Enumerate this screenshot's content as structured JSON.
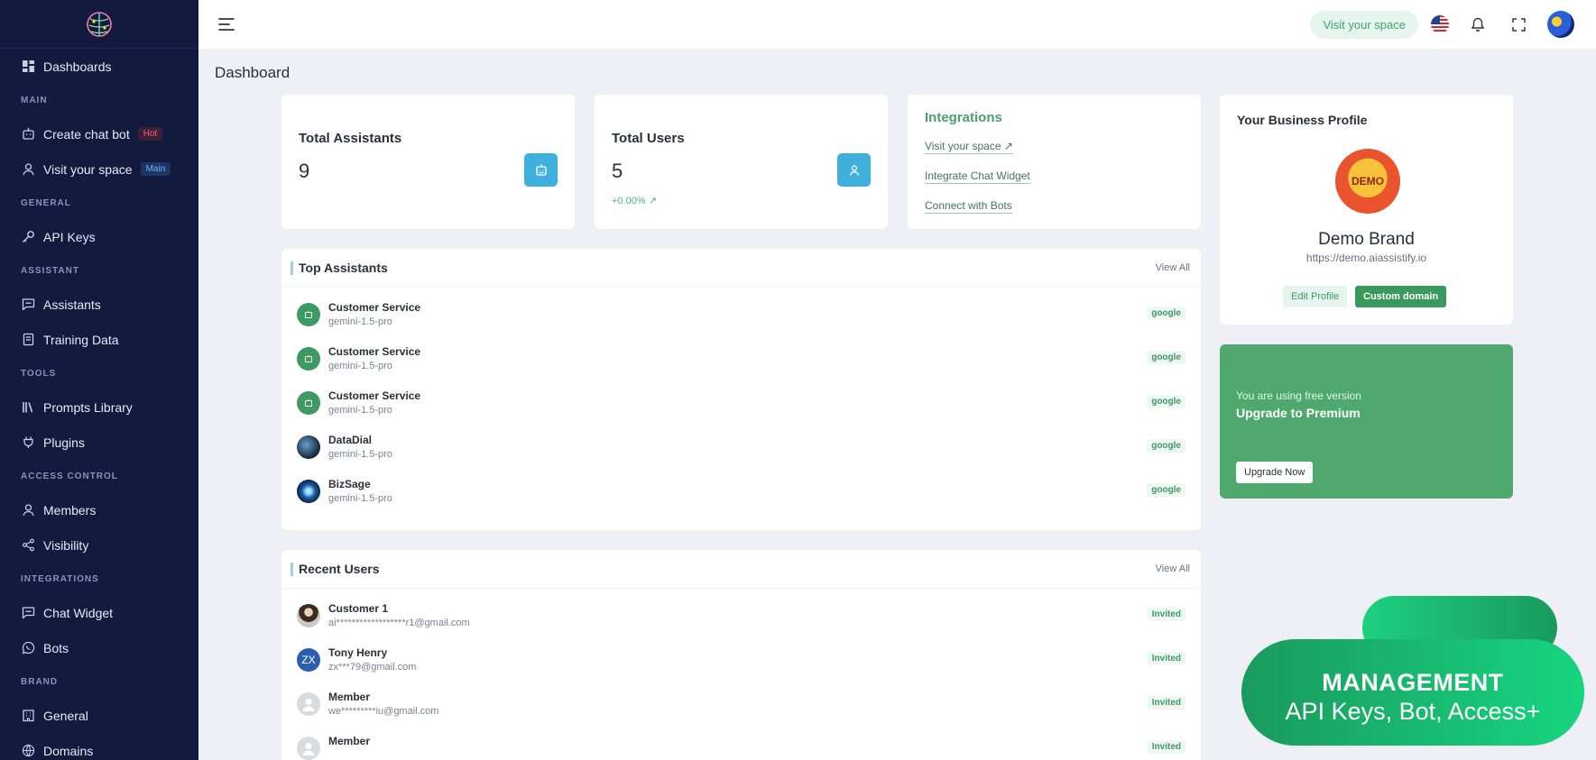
{
  "sidebar": {
    "items": [
      {
        "type": "item",
        "label": "Dashboards",
        "icon": "grid-icon"
      },
      {
        "type": "cat",
        "label": "MAIN"
      },
      {
        "type": "item",
        "label": "Create chat bot",
        "icon": "bot-icon",
        "badge": "Hot",
        "badge_kind": "hot"
      },
      {
        "type": "item",
        "label": "Visit your space",
        "icon": "user-icon",
        "badge": "Main",
        "badge_kind": "main"
      },
      {
        "type": "cat",
        "label": "GENERAL"
      },
      {
        "type": "item",
        "label": "API Keys",
        "icon": "key-icon"
      },
      {
        "type": "cat",
        "label": "ASSISTANT"
      },
      {
        "type": "item",
        "label": "Assistants",
        "icon": "chat-icon"
      },
      {
        "type": "item",
        "label": "Training Data",
        "icon": "book-icon"
      },
      {
        "type": "cat",
        "label": "TOOLS"
      },
      {
        "type": "item",
        "label": "Prompts Library",
        "icon": "library-icon"
      },
      {
        "type": "item",
        "label": "Plugins",
        "icon": "plug-icon"
      },
      {
        "type": "cat",
        "label": "ACCESS CONTROL"
      },
      {
        "type": "item",
        "label": "Members",
        "icon": "user-icon"
      },
      {
        "type": "item",
        "label": "Visibility",
        "icon": "share-icon"
      },
      {
        "type": "cat",
        "label": "INTEGRATIONS"
      },
      {
        "type": "item",
        "label": "Chat Widget",
        "icon": "chat-icon"
      },
      {
        "type": "item",
        "label": "Bots",
        "icon": "whatsapp-icon"
      },
      {
        "type": "cat",
        "label": "BRAND"
      },
      {
        "type": "item",
        "label": "General",
        "icon": "building-icon"
      },
      {
        "type": "item",
        "label": "Domains",
        "icon": "globe-icon"
      }
    ]
  },
  "topbar": {
    "visit_label": "Visit your space"
  },
  "page_title": "Dashboard",
  "stats": {
    "assistants": {
      "title": "Total Assistants",
      "value": "9"
    },
    "users": {
      "title": "Total Users",
      "value": "5",
      "change": "+0.00%"
    }
  },
  "integrations": {
    "title": "Integrations",
    "links": [
      "Visit your space",
      "Integrate Chat Widget",
      "Connect with Bots"
    ]
  },
  "top_assistants": {
    "title": "Top Assistants",
    "view_all": "View All",
    "rows": [
      {
        "name": "Customer Service",
        "model": "gemini-1.5-pro",
        "provider": "google",
        "avatar": "bot"
      },
      {
        "name": "Customer Service",
        "model": "gemini-1.5-pro",
        "provider": "google",
        "avatar": "bot"
      },
      {
        "name": "Customer Service",
        "model": "gemini-1.5-pro",
        "provider": "google",
        "avatar": "bot"
      },
      {
        "name": "DataDial",
        "model": "gemini-1.5-pro",
        "provider": "google",
        "avatar": "dark"
      },
      {
        "name": "BizSage",
        "model": "gemini-1.5-pro",
        "provider": "google",
        "avatar": "blue"
      }
    ]
  },
  "recent_users": {
    "title": "Recent Users",
    "view_all": "View All",
    "rows": [
      {
        "name": "Customer 1",
        "email": "ai******************r1@gmail.com",
        "status": "Invited",
        "avatar": "photo"
      },
      {
        "name": "Tony Henry",
        "email": "zx***79@gmail.com",
        "status": "Invited",
        "avatar": "ZX"
      },
      {
        "name": "Member",
        "email": "we*********iu@gmail.com",
        "status": "Invited",
        "avatar": "ghost"
      },
      {
        "name": "Member",
        "email": "",
        "status": "Invited",
        "avatar": "ghost"
      }
    ]
  },
  "profile": {
    "title": "Your Business Profile",
    "logo_text": "DEMO",
    "brand": "Demo Brand",
    "url": "https://demo.aiassistify.io",
    "edit_label": "Edit Profile",
    "custom_label": "Custom domain"
  },
  "upgrade": {
    "subtitle": "You are using free version",
    "title": "Upgrade to Premium",
    "button": "Upgrade Now"
  },
  "promo": {
    "heading": "MANAGEMENT",
    "desc": "API Keys, Bot, Access+"
  },
  "colors": {
    "sidebar": "#121a3e",
    "accent_green": "#3a9a5e",
    "stat_icon": "#3fb0dc"
  }
}
